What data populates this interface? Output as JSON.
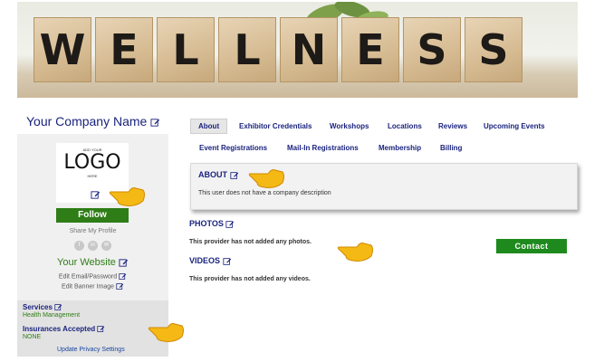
{
  "banner": {
    "letters": [
      "W",
      "E",
      "L",
      "L",
      "N",
      "E",
      "S",
      "S"
    ]
  },
  "company_name": "Your Company Name",
  "logo": {
    "top": "ADD YOUR",
    "main": "LOGO",
    "bottom": "HERE"
  },
  "follow_label": "Follow",
  "share_label": "Share My Profile",
  "social": [
    {
      "icon": "facebook-icon",
      "glyph": "f"
    },
    {
      "icon": "linkedin-icon",
      "glyph": "in"
    },
    {
      "icon": "email-icon",
      "glyph": "✉"
    }
  ],
  "website_label": "Your Website",
  "edit_email_label": "Edit Email/Password",
  "edit_banner_label": "Edit Banner Image",
  "services": {
    "title": "Services",
    "value": "Health Management"
  },
  "insurances": {
    "title": "Insurances Accepted",
    "value": "NONE"
  },
  "privacy_label": "Update Privacy Settings",
  "tabs_row1": [
    "About",
    "Exhibitor Credentials",
    "Workshops",
    "Locations",
    "Reviews",
    "Upcoming Events"
  ],
  "tabs_row2": [
    "Event Registrations",
    "Mail-In Registrations",
    "Membership",
    "Billing"
  ],
  "about": {
    "heading": "ABOUT",
    "text": "This user does not have a company description"
  },
  "photos": {
    "heading": "PHOTOS",
    "text": "This provider has not added any photos."
  },
  "videos": {
    "heading": "VIDEOS",
    "text": "This provider has not added any videos."
  },
  "contact_label": "Contact",
  "colors": {
    "accent_green": "#2e7d16",
    "link_navy": "#1a237e"
  }
}
